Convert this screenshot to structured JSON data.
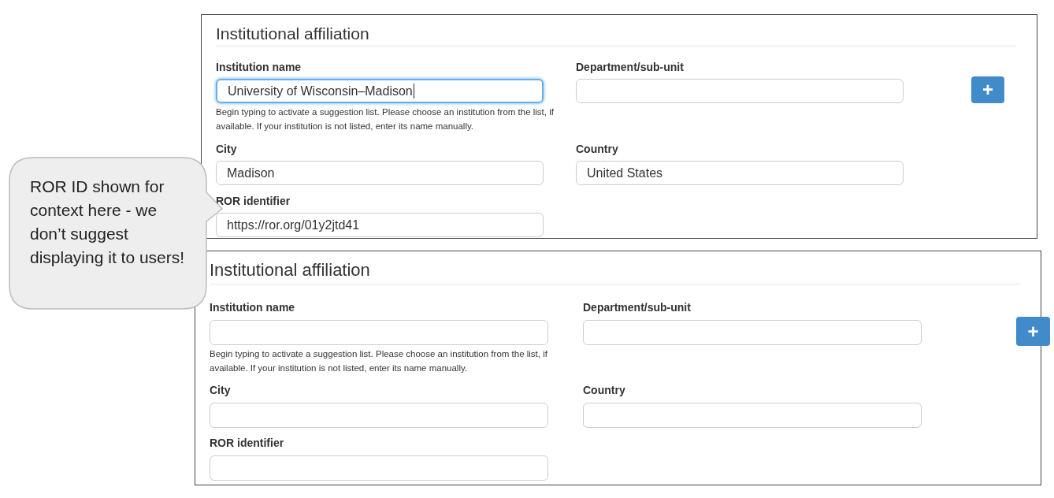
{
  "panels": [
    {
      "title": "Institutional affiliation",
      "add_button": "+",
      "help": "Begin typing to activate a suggestion list. Please choose an institution from the list, if available. If your institution is not listed, enter its name manually.",
      "fields": [
        {
          "label": "Institution name",
          "value": "University of Wisconsin–Madison",
          "focused": true
        },
        {
          "label": "Department/sub-unit",
          "focused": false
        },
        {
          "label": "City",
          "value": "Madison",
          "focused": false
        },
        {
          "label": "Country",
          "value": "United States",
          "focused": false
        },
        {
          "label": "ROR identifier",
          "value": "https://ror.org/01y2jtd41",
          "focused": false
        }
      ]
    },
    {
      "title": "Institutional affiliation",
      "add_button": "+",
      "help": "Begin typing to activate a suggestion list. Please choose an institution from the list, if available. If your institution is not listed, enter its name manually.",
      "fields": [
        {
          "label": "Institution name",
          "focused": false
        },
        {
          "label": "Department/sub-unit",
          "focused": false
        },
        {
          "label": "City",
          "focused": false
        },
        {
          "label": "Country",
          "focused": false
        },
        {
          "label": "ROR identifier",
          "focused": false
        }
      ]
    }
  ],
  "callout": "ROR ID shown for context here - we don’t suggest displaying it to users!"
}
